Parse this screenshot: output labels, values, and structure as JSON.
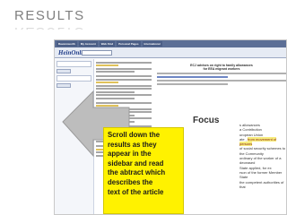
{
  "slide": {
    "title": "RESULTS"
  },
  "browser": {
    "nav_tabs": [
      "Ravensworth",
      "My Account",
      "Web Find",
      "Personal Pages",
      "International"
    ],
    "logo": "HeinOnline",
    "article_title_lines": [
      "ECJ advises on right to family allowances",
      "for EEA migrant workers"
    ],
    "focus_word": "Focus",
    "right_text_lines": [
      "s allowances",
      "a Contribution",
      "uropean Union",
      "ate , from movement of persons",
      "of social security schemes to",
      "the Community",
      "ordinary of the worker of a deceased",
      "State applied, for ex",
      "rson of the former Member State",
      "the competent authorities of that"
    ],
    "highlight_phrase": "from movement of persons"
  },
  "callout": {
    "lines": [
      "Scroll down the",
      "results as they",
      "appear in the",
      "sidebar and read",
      "the abtract which",
      "describes the",
      "text of the article"
    ]
  },
  "colors": {
    "title_gray": "#7f7f7f",
    "callout_yellow": "#fff200",
    "arrow_fill": "#bbbbbb"
  }
}
